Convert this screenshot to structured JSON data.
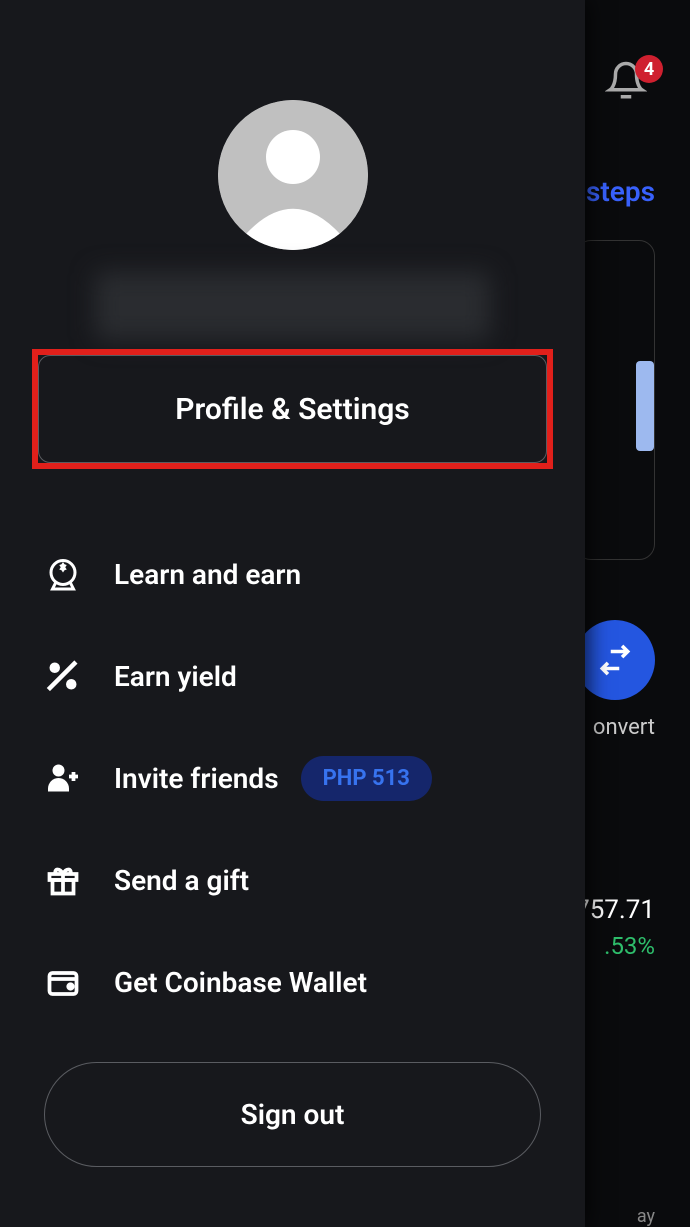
{
  "background": {
    "steps_link": "steps",
    "convert_label": "onvert",
    "price_partial": "757.71",
    "pct_partial": ".53%",
    "notification_count": "4",
    "bottom_text": "ay"
  },
  "drawer": {
    "profile_settings_label": "Profile & Settings",
    "menu": [
      {
        "icon": "learn-earn-icon",
        "label": "Learn and earn",
        "badge": null
      },
      {
        "icon": "percent-icon",
        "label": "Earn yield",
        "badge": null
      },
      {
        "icon": "invite-icon",
        "label": "Invite friends",
        "badge": "PHP 513"
      },
      {
        "icon": "gift-icon",
        "label": "Send a gift",
        "badge": null
      },
      {
        "icon": "wallet-icon",
        "label": "Get Coinbase Wallet",
        "badge": null
      }
    ],
    "sign_out_label": "Sign out"
  }
}
